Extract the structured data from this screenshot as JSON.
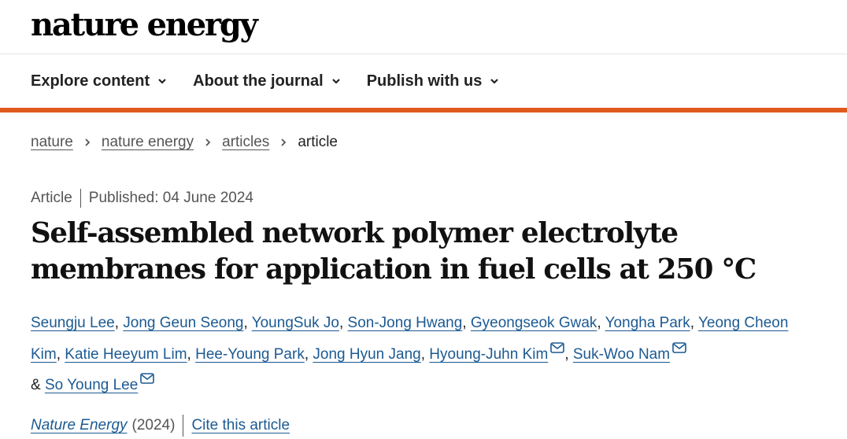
{
  "brand": {
    "logo_text": "nature energy",
    "accent_color": "#e05a1e",
    "link_color": "#1c5a92"
  },
  "nav": {
    "items": [
      {
        "label": "Explore content",
        "icon": "chevron-down-icon"
      },
      {
        "label": "About the journal",
        "icon": "chevron-down-icon"
      },
      {
        "label": "Publish with us",
        "icon": "chevron-down-icon"
      }
    ]
  },
  "breadcrumb": {
    "items": [
      "nature",
      "nature energy",
      "articles"
    ],
    "current": "article",
    "separator_icon": "chevron-right-icon"
  },
  "article": {
    "type": "Article",
    "published": "Published: 04 June 2024",
    "title_line1": "Self-assembled network polymer electrolyte",
    "title_line2": "membranes for application in fuel cells at 250  °C",
    "authors": [
      "Seungju Lee",
      "Jong Geun Seong",
      "YoungSuk Jo",
      "Son-Jong Hwang",
      "Gyeongseok Gwak",
      "Yongha Park",
      "Yeong Cheon Kim",
      "Katie Heeyum Lim",
      "Hee-Young Park",
      "Jong Hyun Jang",
      "Hyoung-Juhn Kim",
      "Suk-Woo Nam",
      "So Young Lee"
    ],
    "author_separator": ", ",
    "final_separator": "& ",
    "corresponding_icon": "envelope-icon",
    "journal": "Nature Energy",
    "year": "(2024)",
    "cite_label": "Cite this article"
  }
}
